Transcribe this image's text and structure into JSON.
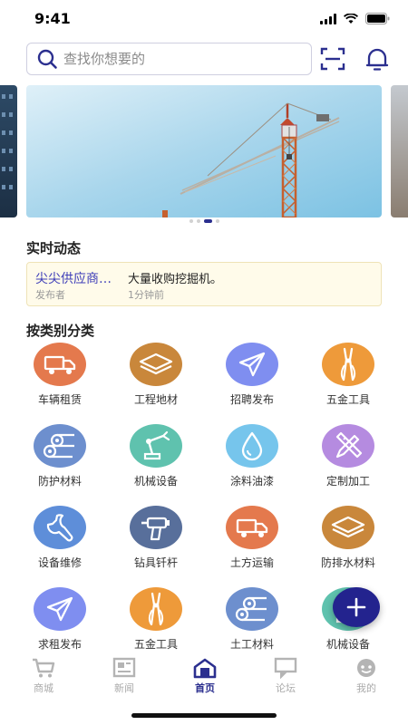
{
  "status_bar": {
    "time": "9:41"
  },
  "search": {
    "placeholder": "查找你想要的"
  },
  "banner": {
    "slide_count": 4,
    "active_slide": 3
  },
  "realtime": {
    "title": "实时动态",
    "publisher": "尖尖供应商…",
    "role": "发布者",
    "content": "大量收购挖掘机。",
    "time": "1分钟前"
  },
  "categories": {
    "title": "按类别分类",
    "items": [
      {
        "label": "车辆租赁",
        "icon": "truck-icon",
        "color": "#e4794d"
      },
      {
        "label": "工程地材",
        "icon": "layers-icon",
        "color": "#c9873b"
      },
      {
        "label": "招聘发布",
        "icon": "paper-plane-icon",
        "color": "#7f8ef0"
      },
      {
        "label": "五金工具",
        "icon": "pliers-icon",
        "color": "#ee9a3a"
      },
      {
        "label": "防护材料",
        "icon": "pipes-icon",
        "color": "#6d8fce"
      },
      {
        "label": "机械设备",
        "icon": "robot-arm-icon",
        "color": "#5fc2ae"
      },
      {
        "label": "涂料油漆",
        "icon": "drop-icon",
        "color": "#76c5ec"
      },
      {
        "label": "定制加工",
        "icon": "pencil-ruler-icon",
        "color": "#b58be0"
      },
      {
        "label": "设备维修",
        "icon": "wrench-icon",
        "color": "#5e8ed9"
      },
      {
        "label": "钻具钎杆",
        "icon": "drill-icon",
        "color": "#586f9b"
      },
      {
        "label": "土方运输",
        "icon": "truck-icon",
        "color": "#e4794d"
      },
      {
        "label": "防排水材料",
        "icon": "layers-icon",
        "color": "#c9873b"
      },
      {
        "label": "求租发布",
        "icon": "paper-plane-icon",
        "color": "#7f8ef0"
      },
      {
        "label": "五金工具",
        "icon": "pliers-icon",
        "color": "#ee9a3a"
      },
      {
        "label": "土工材料",
        "icon": "pipes-icon",
        "color": "#6d8fce"
      },
      {
        "label": "机械设备",
        "icon": "robot-arm-icon",
        "color": "#5fc2ae"
      }
    ]
  },
  "fab": {
    "label": "+"
  },
  "tabbar": {
    "items": [
      {
        "label": "商城",
        "icon": "cart-icon"
      },
      {
        "label": "新闻",
        "icon": "news-icon"
      },
      {
        "label": "首页",
        "icon": "home-icon",
        "active": true
      },
      {
        "label": "论坛",
        "icon": "chat-icon"
      },
      {
        "label": "我的",
        "icon": "user-icon"
      }
    ]
  },
  "colors": {
    "accent": "#2b2f8f",
    "fab": "#23238e",
    "notice_bg": "#fffbea"
  }
}
